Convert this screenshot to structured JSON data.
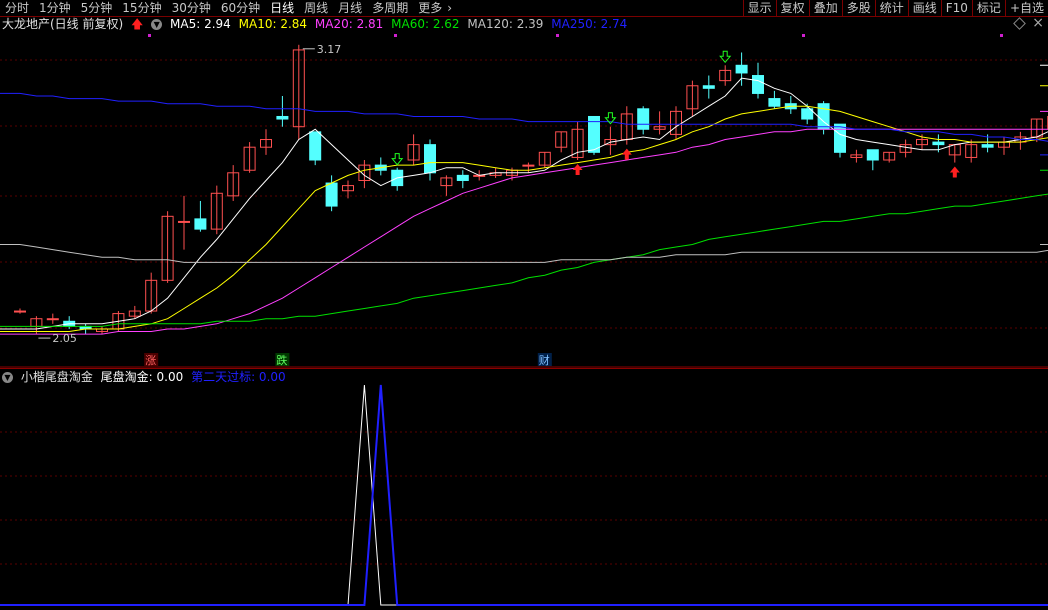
{
  "toolbar": {
    "periods": [
      "分时",
      "1分钟",
      "5分钟",
      "15分钟",
      "30分钟",
      "60分钟",
      "日线",
      "周线",
      "月线",
      "多周期",
      "更多"
    ],
    "active_period": "日线",
    "buttons": [
      "显示",
      "复权",
      "叠加",
      "多股",
      "统计",
      "画线",
      "F10",
      "标记",
      "+自选"
    ]
  },
  "main_legend": {
    "title": "大龙地产(日线 前复权)",
    "ma5": "MA5: 2.94",
    "ma10": "MA10: 2.84",
    "ma20": "MA20: 2.81",
    "ma60": "MA60: 2.62",
    "ma120": "MA120: 2.39",
    "ma250": "MA250: 2.74"
  },
  "sub_legend": {
    "title": "小楷尾盘淘金",
    "v1": "尾盘淘金: 0.00",
    "v2": "第二天过标: 0.00"
  },
  "annotations": {
    "high_label": "3.17",
    "low_label": "2.05",
    "tag_zhang": "涨",
    "tag_die": "跌",
    "tag_cai": "财"
  },
  "colors": {
    "up": "#ff5050",
    "down": "#54ffff",
    "ma5": "#ffffff",
    "ma10": "#ffff00",
    "ma20": "#ff40ff",
    "ma60": "#00e000",
    "ma120": "#c0c0c0",
    "ma250": "#2020ff",
    "signal1": "#ffffff",
    "signal2": "#2020ff"
  },
  "chart_data": [
    {
      "type": "candlestick",
      "ylim": [
        1.97,
        3.22
      ],
      "candles": [
        [
          2.13,
          2.13,
          2.14,
          2.12
        ],
        [
          2.07,
          2.1,
          2.11,
          2.04
        ],
        [
          2.1,
          2.1,
          2.12,
          2.08
        ],
        [
          2.09,
          2.07,
          2.11,
          2.06
        ],
        [
          2.07,
          2.06,
          2.08,
          2.04
        ],
        [
          2.05,
          2.06,
          2.07,
          2.04
        ],
        [
          2.06,
          2.12,
          2.13,
          2.05
        ],
        [
          2.11,
          2.13,
          2.15,
          2.1
        ],
        [
          2.13,
          2.25,
          2.28,
          2.12
        ],
        [
          2.25,
          2.5,
          2.52,
          2.24
        ],
        [
          2.48,
          2.48,
          2.58,
          2.37
        ],
        [
          2.49,
          2.45,
          2.56,
          2.44
        ],
        [
          2.45,
          2.59,
          2.62,
          2.43
        ],
        [
          2.58,
          2.67,
          2.7,
          2.56
        ],
        [
          2.68,
          2.77,
          2.79,
          2.67
        ],
        [
          2.77,
          2.8,
          2.84,
          2.74
        ],
        [
          2.89,
          2.88,
          2.97,
          2.85
        ],
        [
          2.85,
          3.15,
          3.17,
          2.8
        ],
        [
          2.83,
          2.72,
          2.83,
          2.7
        ],
        [
          2.63,
          2.54,
          2.66,
          2.52
        ],
        [
          2.6,
          2.62,
          2.64,
          2.57
        ],
        [
          2.64,
          2.7,
          2.72,
          2.61
        ],
        [
          2.7,
          2.68,
          2.73,
          2.66
        ],
        [
          2.68,
          2.62,
          2.69,
          2.6
        ],
        [
          2.72,
          2.78,
          2.82,
          2.7
        ],
        [
          2.78,
          2.67,
          2.8,
          2.64
        ],
        [
          2.62,
          2.65,
          2.66,
          2.58
        ],
        [
          2.66,
          2.64,
          2.68,
          2.61
        ],
        [
          2.66,
          2.66,
          2.68,
          2.64
        ],
        [
          2.66,
          2.67,
          2.69,
          2.65
        ],
        [
          2.66,
          2.68,
          2.69,
          2.64
        ],
        [
          2.7,
          2.7,
          2.71,
          2.67
        ],
        [
          2.7,
          2.75,
          2.75,
          2.69
        ],
        [
          2.77,
          2.83,
          2.83,
          2.75
        ],
        [
          2.73,
          2.84,
          2.87,
          2.72
        ],
        [
          2.89,
          2.75,
          2.89,
          2.74
        ],
        [
          2.78,
          2.8,
          2.85,
          2.74
        ],
        [
          2.8,
          2.9,
          2.93,
          2.78
        ],
        [
          2.92,
          2.84,
          2.93,
          2.82
        ],
        [
          2.84,
          2.85,
          2.91,
          2.82
        ],
        [
          2.82,
          2.91,
          2.93,
          2.8
        ],
        [
          2.92,
          3.01,
          3.03,
          2.89
        ],
        [
          3.01,
          3.0,
          3.05,
          2.96
        ],
        [
          3.03,
          3.07,
          3.09,
          3.01
        ],
        [
          3.09,
          3.06,
          3.14,
          3.01
        ],
        [
          3.05,
          2.98,
          3.1,
          2.96
        ],
        [
          2.96,
          2.93,
          2.99,
          2.92
        ],
        [
          2.94,
          2.92,
          2.97,
          2.9
        ],
        [
          2.92,
          2.88,
          2.94,
          2.86
        ],
        [
          2.94,
          2.84,
          2.95,
          2.82
        ],
        [
          2.86,
          2.75,
          2.86,
          2.73
        ],
        [
          2.73,
          2.74,
          2.76,
          2.71
        ],
        [
          2.76,
          2.72,
          2.76,
          2.68
        ],
        [
          2.72,
          2.75,
          2.75,
          2.71
        ],
        [
          2.75,
          2.78,
          2.8,
          2.73
        ],
        [
          2.78,
          2.8,
          2.82,
          2.76
        ],
        [
          2.79,
          2.78,
          2.82,
          2.75
        ],
        [
          2.74,
          2.78,
          2.78,
          2.71
        ],
        [
          2.73,
          2.78,
          2.8,
          2.71
        ],
        [
          2.78,
          2.77,
          2.82,
          2.75
        ],
        [
          2.77,
          2.79,
          2.81,
          2.74
        ],
        [
          2.79,
          2.81,
          2.83,
          2.76
        ],
        [
          2.81,
          2.88,
          2.88,
          2.79
        ],
        [
          2.84,
          2.89,
          2.9,
          2.82
        ],
        [
          2.85,
          2.98,
          2.99,
          2.84
        ],
        [
          2.99,
          3.02,
          3.04,
          2.94
        ],
        [
          3.01,
          2.98,
          3.03,
          2.96
        ],
        [
          2.96,
          3.01,
          3.02,
          2.95
        ],
        [
          3.02,
          3.06,
          3.09,
          3.0
        ],
        [
          3.03,
          3.09,
          3.12,
          3.01
        ],
        [
          3.09,
          3.09,
          3.1,
          3.01
        ],
        [
          3.02,
          3.11,
          3.16,
          2.97
        ],
        [
          3.06,
          3.11,
          3.15,
          2.99
        ]
      ],
      "markers": {
        "up_arrows": [
          34,
          37,
          57
        ],
        "down_arrows": [
          23,
          36,
          43
        ]
      },
      "ma_series": [
        {
          "name": "MA5",
          "values": [
            2.06,
            2.06,
            2.07,
            2.08,
            2.08,
            2.08,
            2.09,
            2.1,
            2.13,
            2.18,
            2.26,
            2.34,
            2.41,
            2.49,
            2.57,
            2.64,
            2.71,
            2.8,
            2.84,
            2.78,
            2.72,
            2.66,
            2.62,
            2.65,
            2.66,
            2.67,
            2.69,
            2.69,
            2.66,
            2.67,
            2.67,
            2.67,
            2.68,
            2.72,
            2.75,
            2.76,
            2.79,
            2.8,
            2.81,
            2.8,
            2.85,
            2.89,
            2.93,
            2.97,
            3.04,
            3.03,
            3.0,
            2.98,
            2.93,
            2.87,
            2.82,
            2.8,
            2.79,
            2.78,
            2.77,
            2.76,
            2.76,
            2.78,
            2.79,
            2.79,
            2.79,
            2.8,
            2.81,
            2.84,
            2.88,
            2.93,
            2.96,
            2.98,
            3.02,
            3.05,
            3.05,
            3.07,
            3.09
          ]
        },
        {
          "name": "MA10",
          "values": [
            2.05,
            2.05,
            2.05,
            2.05,
            2.06,
            2.06,
            2.06,
            2.07,
            2.08,
            2.1,
            2.14,
            2.18,
            2.22,
            2.27,
            2.33,
            2.39,
            2.46,
            2.53,
            2.6,
            2.63,
            2.66,
            2.68,
            2.69,
            2.7,
            2.7,
            2.71,
            2.71,
            2.71,
            2.7,
            2.69,
            2.68,
            2.68,
            2.69,
            2.7,
            2.71,
            2.72,
            2.73,
            2.75,
            2.76,
            2.78,
            2.8,
            2.83,
            2.85,
            2.88,
            2.9,
            2.91,
            2.92,
            2.93,
            2.93,
            2.92,
            2.91,
            2.89,
            2.87,
            2.85,
            2.83,
            2.81,
            2.8,
            2.8,
            2.79,
            2.79,
            2.79,
            2.79,
            2.8,
            2.81,
            2.83,
            2.85,
            2.87,
            2.89,
            2.91,
            2.93,
            2.96,
            2.99,
            3.01
          ]
        },
        {
          "name": "MA20",
          "values": [
            2.04,
            2.04,
            2.04,
            2.04,
            2.04,
            2.04,
            2.05,
            2.05,
            2.05,
            2.06,
            2.06,
            2.07,
            2.08,
            2.1,
            2.12,
            2.15,
            2.18,
            2.22,
            2.26,
            2.3,
            2.34,
            2.38,
            2.42,
            2.46,
            2.5,
            2.53,
            2.56,
            2.59,
            2.61,
            2.63,
            2.65,
            2.66,
            2.67,
            2.68,
            2.69,
            2.7,
            2.71,
            2.72,
            2.73,
            2.74,
            2.75,
            2.77,
            2.78,
            2.8,
            2.81,
            2.82,
            2.83,
            2.83,
            2.84,
            2.84,
            2.84,
            2.84,
            2.84,
            2.84,
            2.84,
            2.84,
            2.84,
            2.84,
            2.84,
            2.84,
            2.84,
            2.84,
            2.84,
            2.84,
            2.85,
            2.85,
            2.86,
            2.87,
            2.87,
            2.88,
            2.89,
            2.9,
            2.91
          ]
        },
        {
          "name": "MA60",
          "values": [
            2.07,
            2.07,
            2.07,
            2.07,
            2.07,
            2.07,
            2.08,
            2.08,
            2.08,
            2.08,
            2.08,
            2.08,
            2.09,
            2.09,
            2.09,
            2.1,
            2.1,
            2.11,
            2.11,
            2.12,
            2.13,
            2.14,
            2.15,
            2.16,
            2.18,
            2.19,
            2.2,
            2.21,
            2.22,
            2.23,
            2.24,
            2.26,
            2.27,
            2.29,
            2.3,
            2.32,
            2.33,
            2.34,
            2.35,
            2.37,
            2.38,
            2.39,
            2.41,
            2.42,
            2.43,
            2.44,
            2.45,
            2.46,
            2.47,
            2.48,
            2.48,
            2.49,
            2.5,
            2.51,
            2.51,
            2.52,
            2.53,
            2.54,
            2.54,
            2.55,
            2.56,
            2.57,
            2.58,
            2.59,
            2.6,
            2.61,
            2.62,
            2.63,
            2.64,
            2.65,
            2.66,
            2.67,
            2.68
          ]
        },
        {
          "name": "MA120",
          "values": [
            2.39,
            2.38,
            2.37,
            2.36,
            2.35,
            2.34,
            2.34,
            2.33,
            2.33,
            2.33,
            2.32,
            2.32,
            2.32,
            2.32,
            2.32,
            2.32,
            2.32,
            2.32,
            2.32,
            2.32,
            2.32,
            2.32,
            2.32,
            2.32,
            2.32,
            2.32,
            2.32,
            2.32,
            2.32,
            2.32,
            2.32,
            2.32,
            2.32,
            2.33,
            2.33,
            2.33,
            2.33,
            2.34,
            2.34,
            2.34,
            2.35,
            2.35,
            2.35,
            2.35,
            2.36,
            2.36,
            2.36,
            2.36,
            2.36,
            2.36,
            2.36,
            2.36,
            2.36,
            2.36,
            2.36,
            2.36,
            2.36,
            2.36,
            2.36,
            2.36,
            2.36,
            2.36,
            2.36,
            2.37,
            2.37,
            2.37,
            2.37,
            2.37,
            2.38,
            2.38,
            2.38,
            2.39,
            2.39
          ]
        },
        {
          "name": "MA250",
          "values": [
            2.98,
            2.97,
            2.97,
            2.96,
            2.96,
            2.96,
            2.95,
            2.95,
            2.95,
            2.94,
            2.94,
            2.94,
            2.93,
            2.93,
            2.93,
            2.92,
            2.92,
            2.92,
            2.91,
            2.91,
            2.91,
            2.9,
            2.9,
            2.9,
            2.89,
            2.89,
            2.89,
            2.89,
            2.88,
            2.88,
            2.88,
            2.87,
            2.87,
            2.87,
            2.87,
            2.87,
            2.87,
            2.86,
            2.86,
            2.86,
            2.86,
            2.86,
            2.86,
            2.86,
            2.86,
            2.86,
            2.86,
            2.86,
            2.85,
            2.85,
            2.85,
            2.84,
            2.84,
            2.84,
            2.83,
            2.83,
            2.83,
            2.82,
            2.82,
            2.81,
            2.81,
            2.8,
            2.8,
            2.79,
            2.79,
            2.78,
            2.78,
            2.77,
            2.77,
            2.76,
            2.76,
            2.75,
            2.74
          ]
        }
      ]
    },
    {
      "type": "line",
      "ylim": [
        0,
        1
      ],
      "series": [
        {
          "name": "尾盘淘金",
          "spike_index": 21,
          "values": [
            0,
            1,
            0
          ]
        },
        {
          "name": "第二天过标",
          "spike_index": 22,
          "values": [
            0,
            1,
            0
          ]
        }
      ]
    }
  ]
}
